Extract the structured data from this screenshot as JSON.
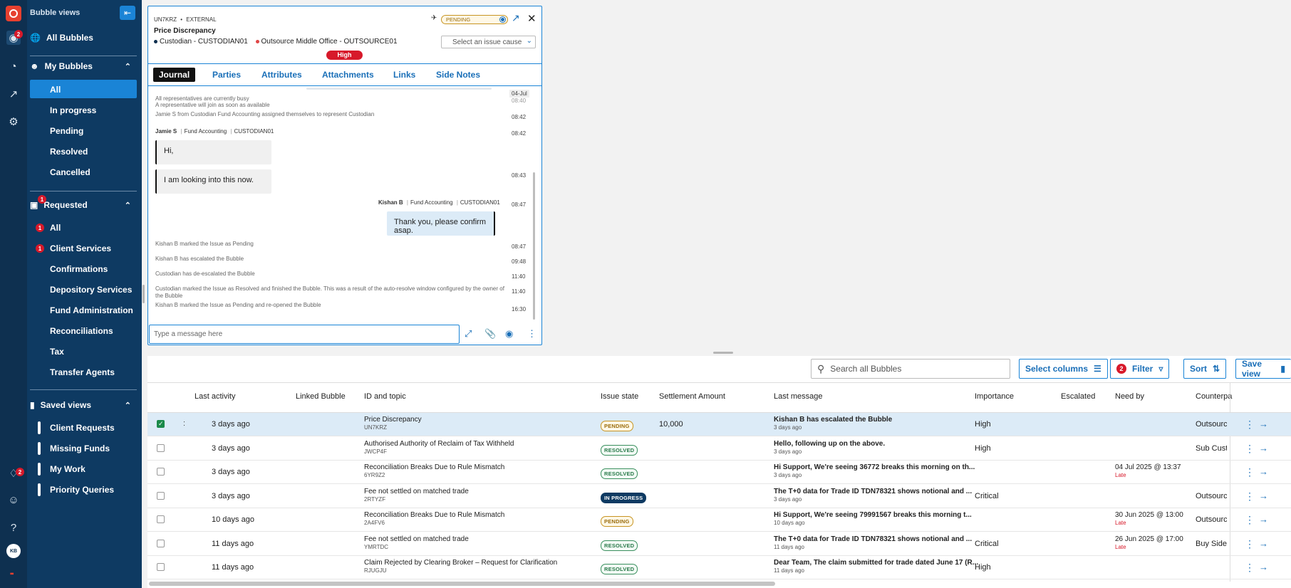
{
  "rail": {
    "notifications_badge": "2",
    "alerts_badge": "2",
    "avatar_initials": "KB"
  },
  "sidebar": {
    "title": "Bubble views",
    "all_bubbles": "All Bubbles",
    "my_bubbles": {
      "label": "My Bubbles",
      "items": [
        "All",
        "In progress",
        "Pending",
        "Resolved",
        "Cancelled"
      ]
    },
    "requested": {
      "label": "Requested",
      "badge": "1",
      "items": [
        {
          "label": "All",
          "badge": "1"
        },
        {
          "label": "Client Services",
          "badge": "1"
        },
        {
          "label": "Confirmations",
          "badge": ""
        },
        {
          "label": "Depository Services",
          "badge": ""
        },
        {
          "label": "Fund Administration",
          "badge": ""
        },
        {
          "label": "Reconciliations",
          "badge": ""
        },
        {
          "label": "Tax",
          "badge": ""
        },
        {
          "label": "Transfer Agents",
          "badge": ""
        }
      ]
    },
    "saved_views": {
      "label": "Saved views",
      "items": [
        "Client Requests",
        "Missing Funds",
        "My Work",
        "Priority Queries"
      ]
    }
  },
  "panel": {
    "id": "UN7KRZ",
    "scope": "EXTERNAL",
    "status": "PENDING",
    "title": "Price Discrepancy",
    "party1": "Custodian - CUSTODIAN01",
    "party2": "Outsource Middle Office - OUTSOURCE01",
    "issue_cause_placeholder": "Select an issue cause",
    "importance": "High",
    "tabs": [
      "Journal",
      "Parties",
      "Attributes",
      "Attachments",
      "Links",
      "Side Notes"
    ],
    "date_marker": "04-Jul",
    "journal": {
      "sys1": "All representatives are currently busy",
      "sys1b": "A representative will join as soon as available",
      "t1": "08:40",
      "sys2": "Jamie S from Custodian Fund Accounting assigned themselves to represent Custodian",
      "t2": "08:42",
      "author1": "Jamie S",
      "author1_team": "Fund Accounting",
      "author1_org": "CUSTODIAN01",
      "t3": "08:42",
      "msg1": "Hi,",
      "msg2": "I am looking into this now.",
      "t4": "08:43",
      "author2": "Kishan B",
      "author2_team": "Fund Accounting",
      "author2_org": "CUSTODIAN01",
      "t5": "08:47",
      "msg3": "Thank you, please confirm asap.",
      "sys3": "Kishan B marked the Issue as Pending",
      "t6": "08:47",
      "sys4": "Kishan B has escalated the Bubble",
      "t7": "09:48",
      "sys5": "Custodian has de-escalated the Bubble",
      "t8": "11:40",
      "sys6": "Custodian marked the Issue as Resolved and finished the Bubble. This was a result of the auto-resolve window configured by the owner of the Bubble",
      "t9": "11:40",
      "sys7": "Kishan B marked the Issue as Pending and re-opened the Bubble",
      "t10": "16:30"
    },
    "composer_placeholder": "Type a message here"
  },
  "toolbar": {
    "search_placeholder": "Search all Bubbles",
    "select_columns": "Select columns",
    "filter": "Filter",
    "filter_badge": "2",
    "sort": "Sort",
    "save_view": "Save view"
  },
  "table": {
    "headers": {
      "last_activity": "Last activity",
      "linked": "Linked Bubble",
      "id_topic": "ID and topic",
      "issue_state": "Issue state",
      "settlement": "Settlement Amount",
      "last_message": "Last message",
      "importance": "Importance",
      "escalated": "Escalated",
      "need_by": "Need by",
      "counterparty": "Counterpa"
    },
    "rows": [
      {
        "activity": "3 days ago",
        "topic": "Price Discrepancy",
        "id": "UN7KRZ",
        "state": "PENDING",
        "settlement": "10,000",
        "message": "Kishan B has escalated the Bubble",
        "message_age": "3 days ago",
        "importance": "High",
        "need_by": "",
        "late": "",
        "counterparty": "Outsource"
      },
      {
        "activity": "3 days ago",
        "topic": "Authorised Authority of Reclaim of Tax Withheld",
        "id": "JWCP4F",
        "state": "RESOLVED",
        "settlement": "",
        "message": "Hello, following up on the above.",
        "message_age": "3 days ago",
        "importance": "High",
        "need_by": "",
        "late": "",
        "counterparty": "Sub Custo"
      },
      {
        "activity": "3 days ago",
        "topic": "Reconciliation Breaks Due to Rule Mismatch",
        "id": "6YR9Z2",
        "state": "RESOLVED",
        "settlement": "",
        "message": "Hi Support, We're seeing 36772 breaks this morning on th...",
        "message_age": "3 days ago",
        "importance": "",
        "need_by": "04 Jul 2025 @ 13:37",
        "late": "Late",
        "counterparty": ""
      },
      {
        "activity": "3 days ago",
        "topic": "Fee not settled on matched trade",
        "id": "2RTYZF",
        "state": "IN PROGRESS",
        "settlement": "",
        "message": "The T+0 data for Trade ID TDN78321 shows notional and ...",
        "message_age": "3 days ago",
        "importance": "Critical",
        "need_by": "",
        "late": "",
        "counterparty": "Outsource"
      },
      {
        "activity": "10 days ago",
        "topic": "Reconciliation Breaks Due to Rule Mismatch",
        "id": "2A4FV6",
        "state": "PENDING",
        "settlement": "",
        "message": "Hi Support, We're seeing 79991567 breaks this morning t...",
        "message_age": "10 days ago",
        "importance": "",
        "need_by": "30 Jun 2025 @ 13:00",
        "late": "Late",
        "counterparty": "Outsource"
      },
      {
        "activity": "11 days ago",
        "topic": "Fee not settled on matched trade",
        "id": "YMRTDC",
        "state": "RESOLVED",
        "settlement": "",
        "message": "The T+0 data for Trade ID TDN78321 shows notional and ...",
        "message_age": "11 days ago",
        "importance": "Critical",
        "need_by": "26 Jun 2025 @ 17:00",
        "late": "Late",
        "counterparty": "Buy Side"
      },
      {
        "activity": "11 days ago",
        "topic": "Claim Rejected by Clearing Broker – Request for Clarification",
        "id": "RJUGJU",
        "state": "RESOLVED",
        "settlement": "",
        "message": "Dear Team, The claim submitted for trade dated June 17 (R...",
        "message_age": "11 days ago",
        "importance": "High",
        "need_by": "",
        "late": "",
        "counterparty": ""
      }
    ]
  }
}
